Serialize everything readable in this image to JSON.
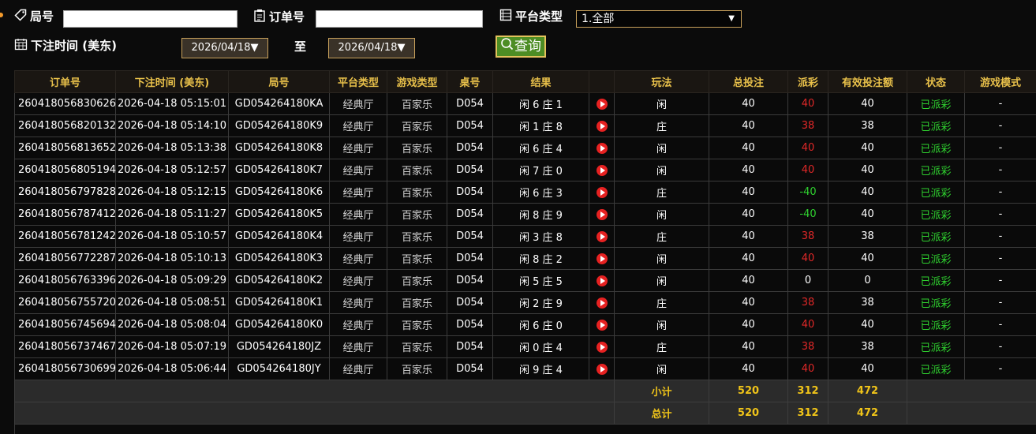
{
  "filters": {
    "round_label": "局号",
    "order_label": "订单号",
    "platform_label": "平台类型",
    "platform_value": "1.全部",
    "time_label": "下注时间 (美东)",
    "date_from": "2026/04/18▼",
    "to_label": "至",
    "date_to": "2026/04/18▼",
    "query_label": "查询"
  },
  "table": {
    "headers": [
      "订单号",
      "下注时间 (美东)",
      "局号",
      "平台类型",
      "游戏类型",
      "桌号",
      "结果",
      "",
      "玩法",
      "总投注",
      "派彩",
      "有效投注额",
      "状态",
      "游戏模式"
    ],
    "rows": [
      [
        "260418056830626",
        "2026-04-18 05:15:01",
        "GD054264180KA",
        "经典厅",
        "百家乐",
        "D054",
        "闲 6 庄 1",
        "闲",
        "40",
        "40",
        "40",
        "已派彩",
        "-"
      ],
      [
        "260418056820132",
        "2026-04-18 05:14:10",
        "GD054264180K9",
        "经典厅",
        "百家乐",
        "D054",
        "闲 1 庄 8",
        "庄",
        "40",
        "38",
        "38",
        "已派彩",
        "-"
      ],
      [
        "260418056813652",
        "2026-04-18 05:13:38",
        "GD054264180K8",
        "经典厅",
        "百家乐",
        "D054",
        "闲 6 庄 4",
        "闲",
        "40",
        "40",
        "40",
        "已派彩",
        "-"
      ],
      [
        "260418056805194",
        "2026-04-18 05:12:57",
        "GD054264180K7",
        "经典厅",
        "百家乐",
        "D054",
        "闲 7 庄 0",
        "闲",
        "40",
        "40",
        "40",
        "已派彩",
        "-"
      ],
      [
        "260418056797828",
        "2026-04-18 05:12:15",
        "GD054264180K6",
        "经典厅",
        "百家乐",
        "D054",
        "闲 6 庄 3",
        "庄",
        "40",
        "-40",
        "40",
        "已派彩",
        "-"
      ],
      [
        "260418056787412",
        "2026-04-18 05:11:27",
        "GD054264180K5",
        "经典厅",
        "百家乐",
        "D054",
        "闲 8 庄 9",
        "闲",
        "40",
        "-40",
        "40",
        "已派彩",
        "-"
      ],
      [
        "260418056781242",
        "2026-04-18 05:10:57",
        "GD054264180K4",
        "经典厅",
        "百家乐",
        "D054",
        "闲 3 庄 8",
        "庄",
        "40",
        "38",
        "38",
        "已派彩",
        "-"
      ],
      [
        "260418056772287",
        "2026-04-18 05:10:13",
        "GD054264180K3",
        "经典厅",
        "百家乐",
        "D054",
        "闲 8 庄 2",
        "闲",
        "40",
        "40",
        "40",
        "已派彩",
        "-"
      ],
      [
        "260418056763396",
        "2026-04-18 05:09:29",
        "GD054264180K2",
        "经典厅",
        "百家乐",
        "D054",
        "闲 5 庄 5",
        "闲",
        "40",
        "0",
        "0",
        "已派彩",
        "-"
      ],
      [
        "260418056755720",
        "2026-04-18 05:08:51",
        "GD054264180K1",
        "经典厅",
        "百家乐",
        "D054",
        "闲 2 庄 9",
        "庄",
        "40",
        "38",
        "38",
        "已派彩",
        "-"
      ],
      [
        "260418056745694",
        "2026-04-18 05:08:04",
        "GD054264180K0",
        "经典厅",
        "百家乐",
        "D054",
        "闲 6 庄 0",
        "闲",
        "40",
        "40",
        "40",
        "已派彩",
        "-"
      ],
      [
        "260418056737467",
        "2026-04-18 05:07:19",
        "GD054264180JZ",
        "经典厅",
        "百家乐",
        "D054",
        "闲 0 庄 4",
        "庄",
        "40",
        "38",
        "38",
        "已派彩",
        "-"
      ],
      [
        "260418056730699",
        "2026-04-18 05:06:44",
        "GD054264180JY",
        "经典厅",
        "百家乐",
        "D054",
        "闲 9 庄 4",
        "闲",
        "40",
        "40",
        "40",
        "已派彩",
        "-"
      ]
    ],
    "subtotal": {
      "label": "小计",
      "total_bet": "520",
      "payout": "312",
      "valid_bet": "472"
    },
    "total": {
      "label": "总计",
      "total_bet": "520",
      "payout": "312",
      "valid_bet": "472"
    }
  },
  "colors": {
    "accent": "#e8c04a",
    "win": "#2fd12f",
    "loss": "#e02828",
    "query_bg": "#4d8d24"
  },
  "icons": {
    "round": "tag-icon",
    "order": "clipboard-icon",
    "platform": "list-icon",
    "time": "calendar-icon",
    "query": "search-icon",
    "video": "play-icon"
  }
}
